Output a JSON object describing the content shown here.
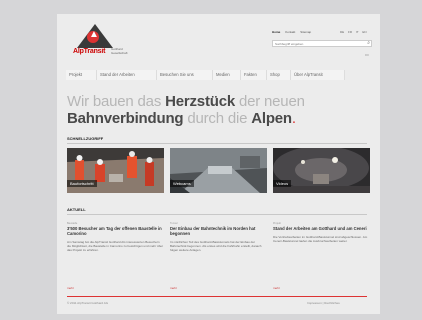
{
  "header": {
    "logo_name": "AlpTransit",
    "logo_sub": "Gotthard Gesellschaft",
    "top_links": [
      "Home",
      "Kontakt",
      "Sitemap"
    ],
    "languages": [
      "DE",
      "FR",
      "IT",
      "EN"
    ],
    "search_placeholder": "Suchbegriff eingeben"
  },
  "nav": [
    "Projekt",
    "Stand der Arbeiten",
    "Besuchen Sie uns",
    "Medien",
    "Fakten",
    "Shop",
    "Über AlpTransit"
  ],
  "headline": {
    "p1": "Wir bauen das ",
    "h1": "Herzstück",
    "p2": " der neuen ",
    "h2": "Bahnverbindung",
    "p3": " durch die ",
    "h3": "Alpen",
    "dot": "."
  },
  "quick": {
    "title": "SCHNELLZUGRIFF",
    "tiles": [
      {
        "label": "Baufortschritt"
      },
      {
        "label": "Webcams"
      },
      {
        "label": "Videos"
      }
    ]
  },
  "news": {
    "title": "AKTUELL",
    "items": [
      {
        "cat": "Baustelle",
        "title": "3'500 Besucher am Tag der offenen Baustelle in Camorino",
        "text": "Am Samstag bot die AlpTransit Gotthard AG interessierten Besuchern die Möglichkeit, die Baustelle in Camorino zu besichtigen und mehr über das Projekt zu erfahren.",
        "more": "mehr"
      },
      {
        "cat": "Tunnel",
        "title": "Der Einbau der Bahntechnik im Norden hat begonnen",
        "text": "Im nördlichen Teil des Gotthard-Basistunnels hat der Einbau der Bahntechnik begonnen. Als erstes wird die Fahrbahn erstellt, danach folgen weitere Anlagen.",
        "more": "mehr"
      },
      {
        "cat": "Projekt",
        "title": "Stand der Arbeiten am Gotthard und am Ceneri",
        "text": "Die Vortriebsarbeiten im Gotthard-Basistunnel sind abgeschlossen. Am Ceneri-Basistunnel laufen die Ausbruchsarbeiten weiter.",
        "more": "mehr"
      }
    ]
  },
  "footer": {
    "copyright": "© 2011 AlpTransit Gotthard AG",
    "links": "Impressum | Rechtliches"
  }
}
